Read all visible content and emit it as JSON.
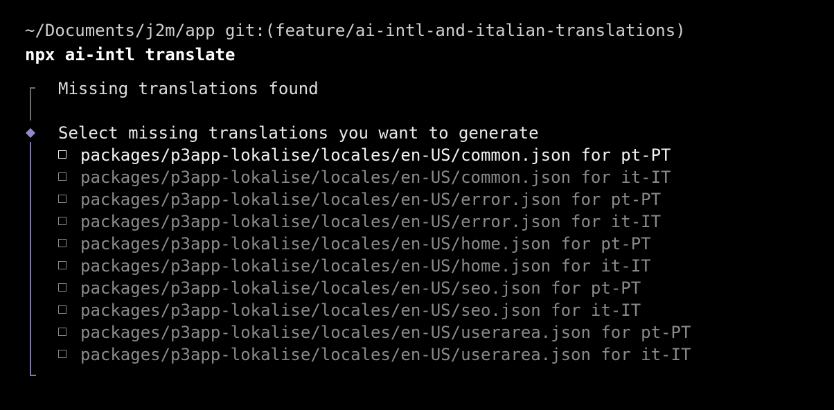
{
  "terminal": {
    "prompt_path": "~/Documents/j2m/app git:(feature/ai-intl-and-italian-translations)",
    "command": "npx ai-intl translate",
    "step_title": "Missing translations found",
    "question": "Select missing translations you want to generate",
    "options": [
      {
        "label": "packages/p3app-lokalise/locales/en-US/common.json for pt-PT",
        "active": true,
        "checked": false
      },
      {
        "label": "packages/p3app-lokalise/locales/en-US/common.json for it-IT",
        "active": false,
        "checked": false
      },
      {
        "label": "packages/p3app-lokalise/locales/en-US/error.json for pt-PT",
        "active": false,
        "checked": false
      },
      {
        "label": "packages/p3app-lokalise/locales/en-US/error.json for it-IT",
        "active": false,
        "checked": false
      },
      {
        "label": "packages/p3app-lokalise/locales/en-US/home.json for pt-PT",
        "active": false,
        "checked": false
      },
      {
        "label": "packages/p3app-lokalise/locales/en-US/home.json for it-IT",
        "active": false,
        "checked": false
      },
      {
        "label": "packages/p3app-lokalise/locales/en-US/seo.json for pt-PT",
        "active": false,
        "checked": false
      },
      {
        "label": "packages/p3app-lokalise/locales/en-US/seo.json for it-IT",
        "active": false,
        "checked": false
      },
      {
        "label": "packages/p3app-lokalise/locales/en-US/userarea.json for pt-PT",
        "active": false,
        "checked": false
      },
      {
        "label": "packages/p3app-lokalise/locales/en-US/userarea.json for it-IT",
        "active": false,
        "checked": false
      }
    ]
  },
  "colors": {
    "background": "#000000",
    "active_text": "#f2f2f2",
    "inactive_text": "#8a8a8a",
    "accent": "#8f8ac8"
  },
  "icons": {
    "active_step": "diamond-icon",
    "unchecked": "checkbox-icon"
  }
}
